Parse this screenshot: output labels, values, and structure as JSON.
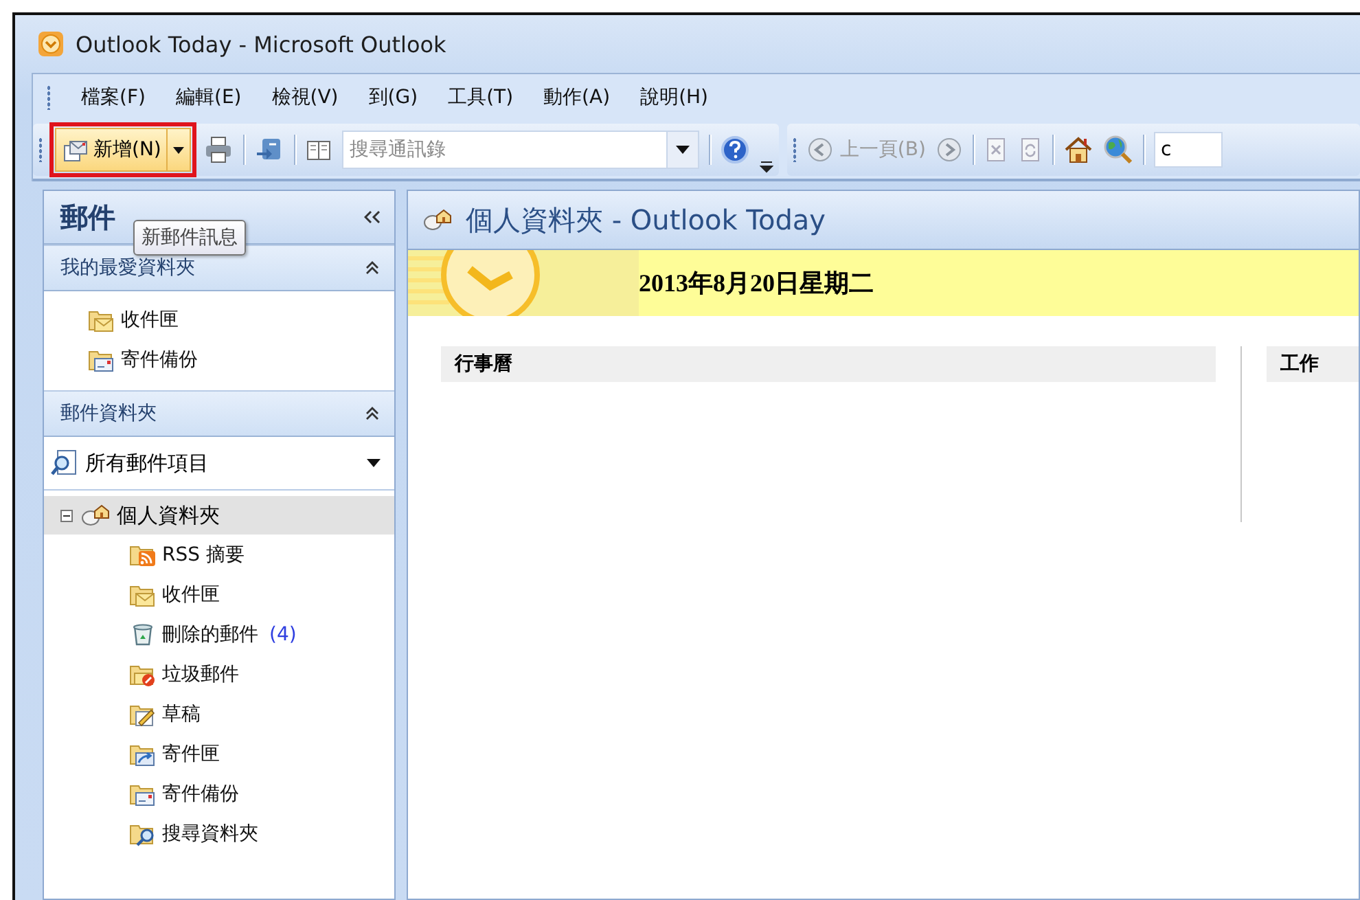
{
  "window": {
    "title": "Outlook Today - Microsoft Outlook"
  },
  "menu": [
    {
      "label": "檔案(F)"
    },
    {
      "label": "編輯(E)"
    },
    {
      "label": "檢視(V)"
    },
    {
      "label": "到(G)"
    },
    {
      "label": "工具(T)"
    },
    {
      "label": "動作(A)"
    },
    {
      "label": "說明(H)"
    }
  ],
  "toolbar": {
    "new_button": {
      "label": "新增(N)",
      "highlighted": true
    },
    "address_search": {
      "placeholder": "搜尋通訊錄"
    },
    "back_button": {
      "label": "上一頁(B)",
      "disabled": true
    },
    "web_field": {
      "value": "c"
    }
  },
  "tooltip": {
    "text": "新郵件訊息"
  },
  "nav_pane": {
    "title": "郵件",
    "favorites": {
      "title": "我的最愛資料夾",
      "expanded": true,
      "items": [
        {
          "label": "收件匣",
          "kind": "inbox"
        },
        {
          "label": "寄件備份",
          "kind": "sent"
        }
      ]
    },
    "mail_folders": {
      "title": "郵件資料夾",
      "expanded": true
    },
    "view_selector": {
      "value": "所有郵件項目"
    },
    "tree": {
      "label": "個人資料夾",
      "expanded": true,
      "selected": true,
      "children": [
        {
          "label": "RSS 摘要",
          "kind": "rss"
        },
        {
          "label": "收件匣",
          "kind": "inbox"
        },
        {
          "label": "刪除的郵件",
          "kind": "deleted",
          "count": "(4)"
        },
        {
          "label": "垃圾郵件",
          "kind": "junk"
        },
        {
          "label": "草稿",
          "kind": "drafts"
        },
        {
          "label": "寄件匣",
          "kind": "outbox"
        },
        {
          "label": "寄件備份",
          "kind": "sent"
        },
        {
          "label": "搜尋資料夾",
          "kind": "search"
        }
      ]
    }
  },
  "content": {
    "title": "個人資料夾 - Outlook Today",
    "date": "2013年8月20日星期二",
    "sections": [
      {
        "title": "行事曆"
      },
      {
        "title": "工作"
      }
    ]
  }
}
